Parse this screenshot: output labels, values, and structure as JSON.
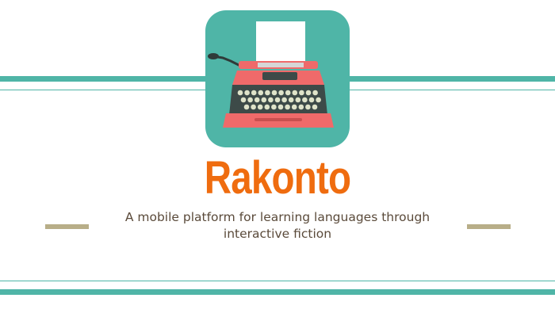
{
  "slide": {
    "title": "Rakonto",
    "subtitle": "A mobile platform for learning languages through interactive fiction"
  },
  "icons": {
    "app_icon": "typewriter-icon"
  },
  "colors": {
    "teal": "#4fb5a7",
    "title_orange": "#ef6c0f",
    "subtitle_text": "#5a4a3a",
    "dash_khaki": "#b8ae88",
    "typewriter_coral": "#ef6a6a",
    "typewriter_dark": "#3d4a48",
    "key_cream": "#dfe3c9",
    "paper": "#ffffff"
  }
}
